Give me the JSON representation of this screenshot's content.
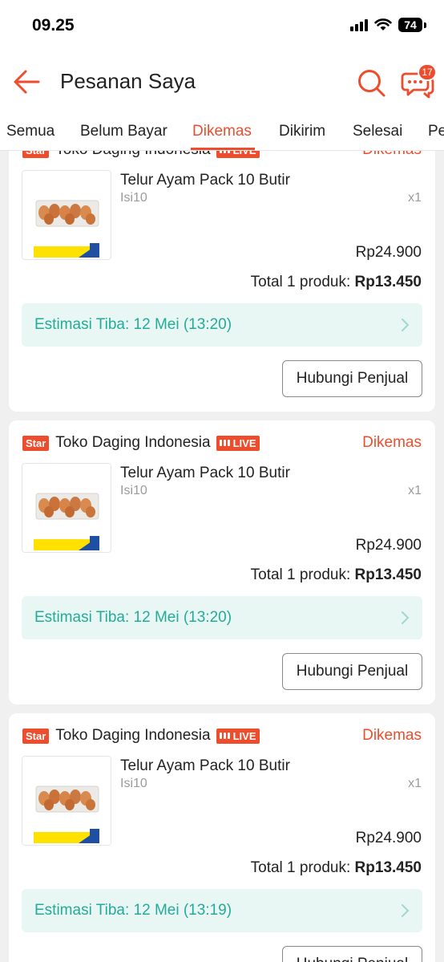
{
  "status_bar": {
    "time": "09.25",
    "battery": "74"
  },
  "header": {
    "title": "Pesanan Saya",
    "chat_badge": "17"
  },
  "tabs": [
    {
      "label": "Semua"
    },
    {
      "label": "Belum Bayar"
    },
    {
      "label": "Dikemas"
    },
    {
      "label": "Dikirim"
    },
    {
      "label": "Selesai"
    },
    {
      "label": "Pe"
    }
  ],
  "active_tab": "Dikemas",
  "colors": {
    "accent": "#ee4d2d",
    "eta_text": "#26aa99",
    "eta_bg": "#e8f7f4"
  },
  "orders": [
    {
      "star": "Star",
      "shop": "Toko Daging Indonesia",
      "live": "LIVE",
      "status": "Dikemas",
      "product": "Telur Ayam Pack 10 Butir",
      "variant": "Isi10",
      "qty": "x1",
      "thumb_label": "Telur Ayam Negeri",
      "price": "Rp24.900",
      "total_label": "Total 1 produk:",
      "total_value": "Rp13.450",
      "eta": "Estimasi Tiba: 12 Mei (13:20)",
      "contact": "Hubungi Penjual"
    },
    {
      "star": "Star",
      "shop": "Toko Daging Indonesia",
      "live": "LIVE",
      "status": "Dikemas",
      "product": "Telur Ayam Pack 10 Butir",
      "variant": "Isi10",
      "qty": "x1",
      "thumb_label": "Telur Ayam Negeri",
      "price": "Rp24.900",
      "total_label": "Total 1 produk:",
      "total_value": "Rp13.450",
      "eta": "Estimasi Tiba: 12 Mei (13:20)",
      "contact": "Hubungi Penjual"
    },
    {
      "star": "Star",
      "shop": "Toko Daging Indonesia",
      "live": "LIVE",
      "status": "Dikemas",
      "product": "Telur Ayam Pack 10 Butir",
      "variant": "Isi10",
      "qty": "x1",
      "thumb_label": "Telur Ayam Negeri",
      "price": "Rp24.900",
      "total_label": "Total 1 produk:",
      "total_value": "Rp13.450",
      "eta": "Estimasi Tiba: 12 Mei (13:19)",
      "contact": "Hubungi Penjual"
    }
  ]
}
